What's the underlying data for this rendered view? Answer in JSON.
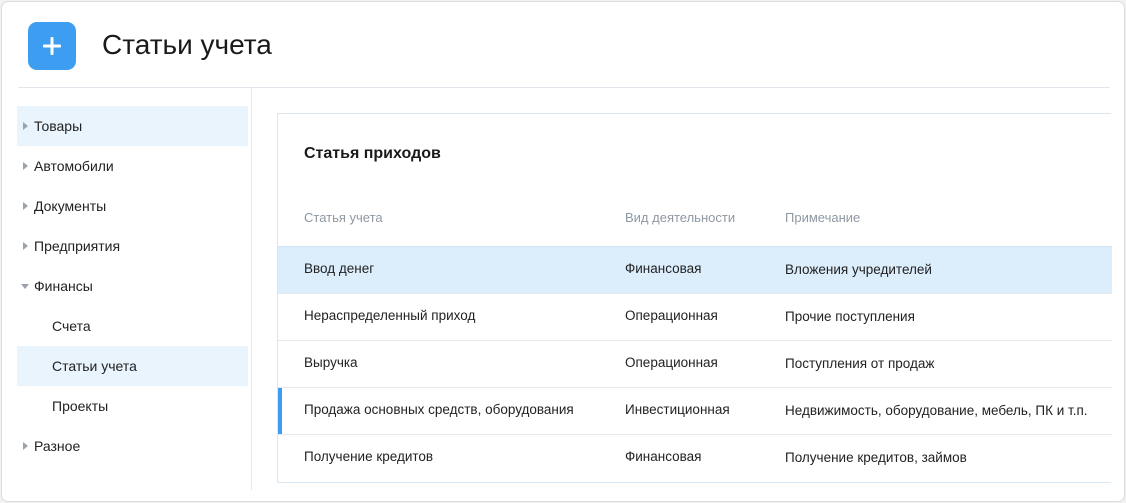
{
  "header": {
    "title": "Статьи учета",
    "add_icon": "plus-icon"
  },
  "colors": {
    "accent": "#3d9df0",
    "selected_row": "#dcedfc",
    "sidebar_active": "#e9f4fd"
  },
  "sidebar": {
    "items": [
      {
        "label": "Товары",
        "icon": "caret-right-icon"
      },
      {
        "label": "Автомобили",
        "icon": "caret-right-icon"
      },
      {
        "label": "Документы",
        "icon": "caret-right-icon"
      },
      {
        "label": "Предприятия",
        "icon": "caret-right-icon"
      },
      {
        "label": "Финансы",
        "icon": "caret-down-icon"
      },
      {
        "label": "Счета"
      },
      {
        "label": "Статьи учета"
      },
      {
        "label": "Проекты"
      },
      {
        "label": "Разное",
        "icon": "caret-right-icon"
      }
    ]
  },
  "main": {
    "section_title": "Статья приходов",
    "columns": [
      "Статья учета",
      "Вид деятельности",
      "Примечание"
    ],
    "rows": [
      {
        "article": "Ввод денег",
        "activity": "Финансовая",
        "note": "Вложения учредителей"
      },
      {
        "article": "Нераспределенный приход",
        "activity": "Операционная",
        "note": "Прочие поступления"
      },
      {
        "article": "Выручка",
        "activity": "Операционная",
        "note": "Поступления от продаж"
      },
      {
        "article": "Продажа основных средств, оборудования",
        "activity": "Инвестиционная",
        "note": "Недвижимость, оборудование, мебель, ПК и т.п."
      },
      {
        "article": "Получение кредитов",
        "activity": "Финансовая",
        "note": "Получение кредитов, займов"
      }
    ]
  }
}
